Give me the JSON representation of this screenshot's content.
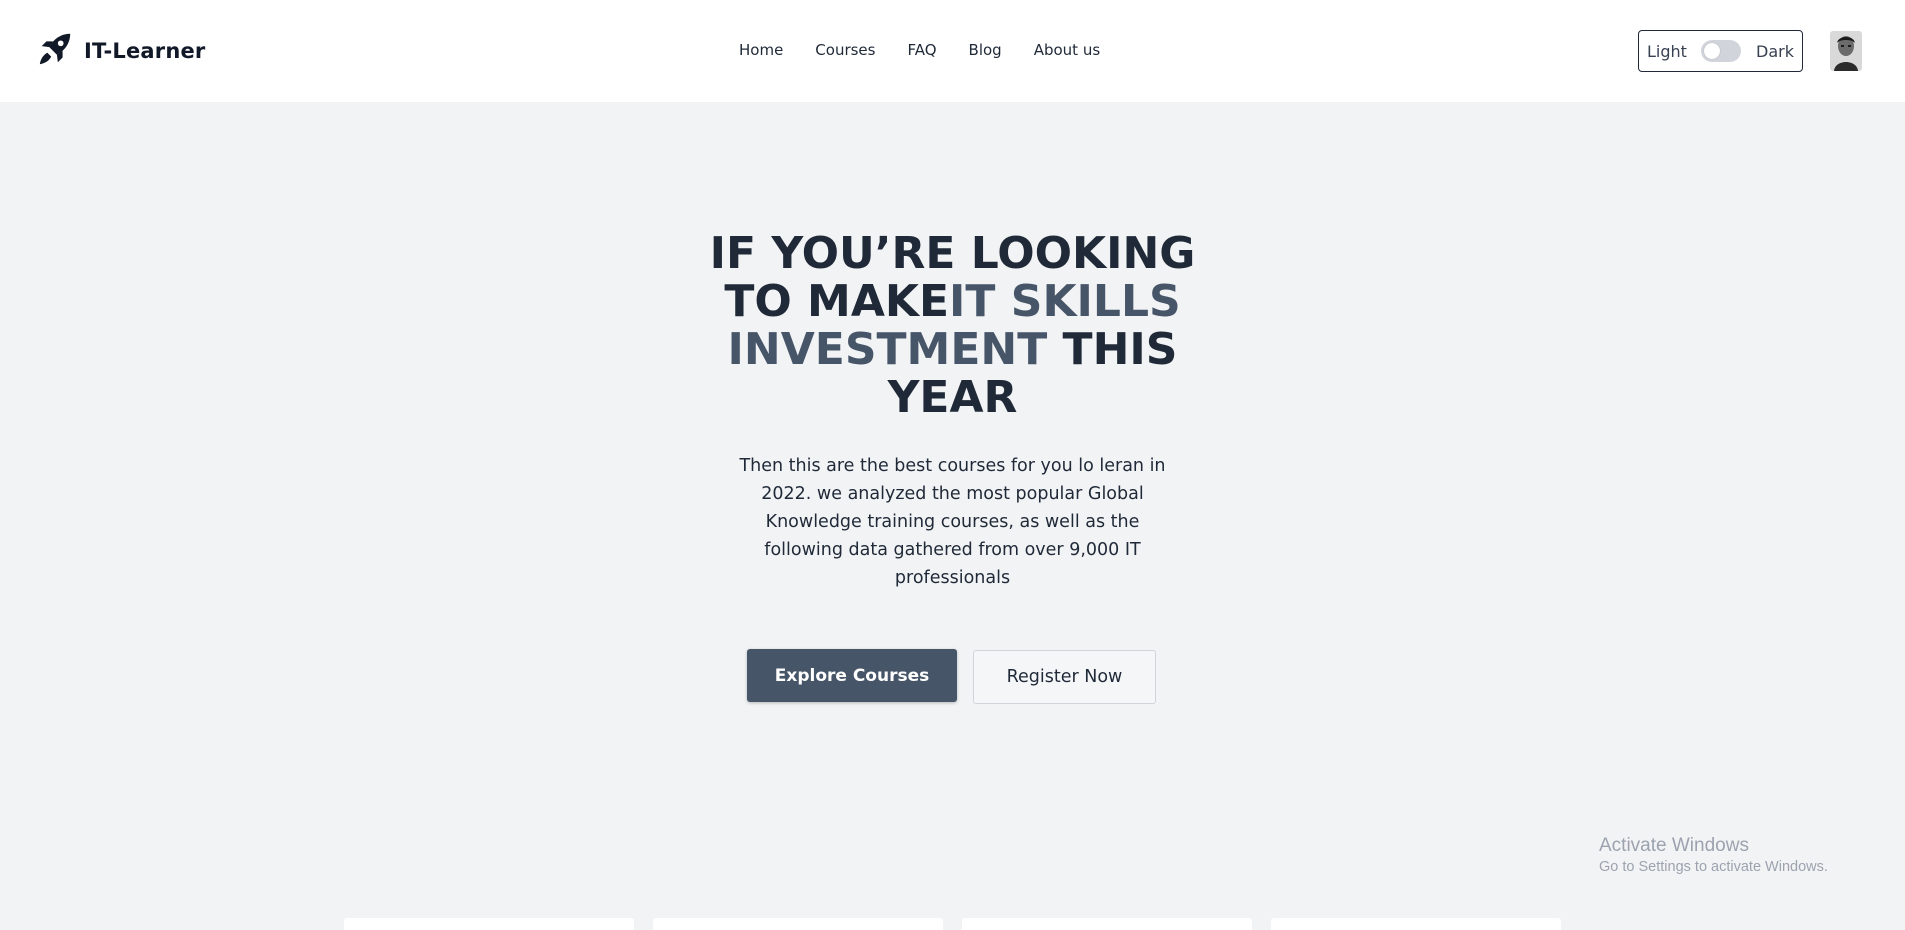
{
  "brand": {
    "name": "IT-Learner",
    "logo_icon": "rocket-icon"
  },
  "nav": {
    "links": [
      "Home",
      "Courses",
      "FAQ",
      "Blog",
      "About us"
    ]
  },
  "theme_toggle": {
    "light_label": "Light",
    "dark_label": "Dark",
    "state": "light"
  },
  "user": {
    "avatar_icon": "user-avatar"
  },
  "hero": {
    "title_part1": "IF YOU’RE LOOKING TO MAKE",
    "title_accent": "IT SKILLS INVESTMENT",
    "title_part2": " THIS YEAR",
    "description": "Then this are the best courses for you lo leran in 2022. we analyzed the most popular Global Knowledge training courses, as well as the following data gathered from over 9,000 IT professionals",
    "primary_button": "Explore Courses",
    "secondary_button": "Register Now"
  },
  "watermark": {
    "title": "Activate Windows",
    "subtitle": "Go to Settings to activate Windows."
  },
  "colors": {
    "background": "#f2f3f5",
    "navbar": "#ffffff",
    "heading": "#1f2937",
    "accent": "#475569",
    "primary_button": "#475569"
  }
}
